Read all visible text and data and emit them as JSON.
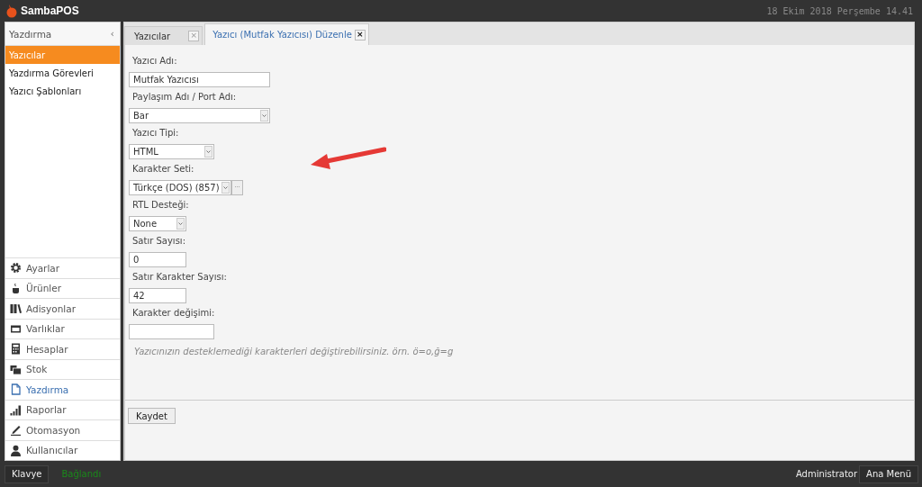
{
  "app": {
    "logo": "SambaPOS",
    "datetime": "18 Ekim 2018 Perşembe 14.41"
  },
  "sidebar": {
    "title": "Yazdırma",
    "collapse": "‹",
    "items": [
      {
        "label": "Yazıcılar",
        "selected": true
      },
      {
        "label": "Yazdırma Görevleri",
        "selected": false
      },
      {
        "label": "Yazıcı Şablonları",
        "selected": false
      }
    ],
    "nav": [
      {
        "label": "Ayarlar",
        "kind": "gear",
        "selected": false
      },
      {
        "label": "Ürünler",
        "kind": "cup",
        "selected": false
      },
      {
        "label": "Adisyonlar",
        "kind": "books",
        "selected": false
      },
      {
        "label": "Varlıklar",
        "kind": "card",
        "selected": false
      },
      {
        "label": "Hesaplar",
        "kind": "calculator",
        "selected": false
      },
      {
        "label": "Stok",
        "kind": "stack",
        "selected": false
      },
      {
        "label": "Yazdırma",
        "kind": "document",
        "selected": true
      },
      {
        "label": "Raporlar",
        "kind": "bars",
        "selected": false
      },
      {
        "label": "Otomasyon",
        "kind": "pen",
        "selected": false
      },
      {
        "label": "Kullanıcılar",
        "kind": "user",
        "selected": false
      }
    ]
  },
  "tabs": [
    {
      "label": "Yazıcılar",
      "close": "×",
      "selected": false
    },
    {
      "label": "Yazıcı (Mutfak Yazıcısı) Düzenle",
      "close": "×",
      "selected": true
    }
  ],
  "form": {
    "fields": [
      {
        "label": "Yazıcı Adı:",
        "kind": "text",
        "value": "Mutfak Yazıcısı"
      },
      {
        "label": "Paylaşım Adı / Port Adı:",
        "kind": "select",
        "value": "Bar"
      },
      {
        "label": "Yazıcı Tipi:",
        "kind": "select",
        "value": "HTML"
      },
      {
        "label": "Karakter Seti:",
        "kind": "select-more",
        "value": "Türkçe (DOS) (857)",
        "more": "···"
      },
      {
        "label": "RTL Desteği:",
        "kind": "select",
        "value": "None"
      },
      {
        "label": "Satır Sayısı:",
        "kind": "text",
        "value": "0"
      },
      {
        "label": "Satır Karakter Sayısı:",
        "kind": "text",
        "value": "42"
      },
      {
        "label": "Karakter değişimi:",
        "kind": "text"
      }
    ],
    "hint": "Yazıcınızın desteklemediği karakterleri değiştirebilirsiniz. örn. ö=o,ğ=g",
    "save": "Kaydet"
  },
  "status_bar": {
    "keyboard": "Klavye",
    "connection": "Bağlandı",
    "connected": true,
    "user": "Administrator",
    "menu": "Ana Menü"
  }
}
